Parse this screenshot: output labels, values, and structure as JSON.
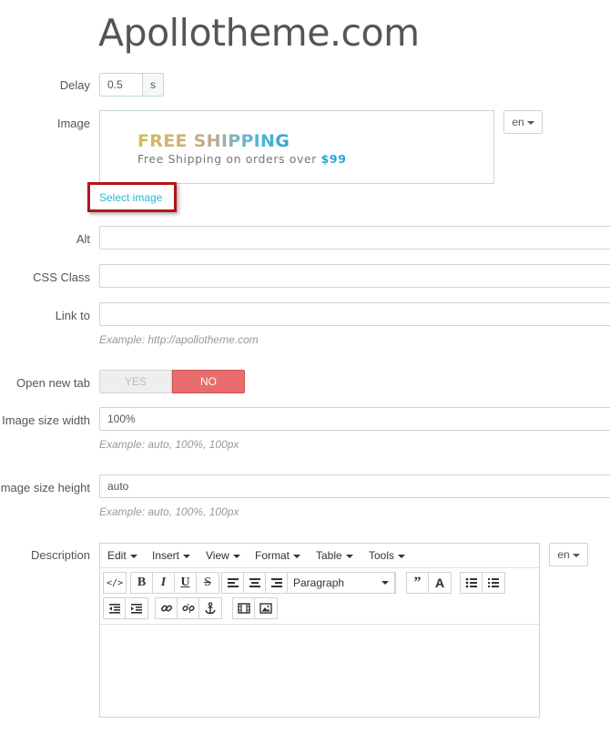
{
  "page": {
    "title": "Apollotheme.com"
  },
  "form": {
    "delay": {
      "label": "Delay",
      "value": "0.5",
      "unit": "s"
    },
    "image": {
      "label": "Image",
      "banner": {
        "title": "FREE SHIPPING",
        "subtitle": "Free Shipping on orders over",
        "price": "$99"
      },
      "select_link": "Select image",
      "language": "en"
    },
    "alt": {
      "label": "Alt",
      "value": ""
    },
    "css_class": {
      "label": "CSS Class",
      "value": ""
    },
    "link_to": {
      "label": "Link to",
      "value": "",
      "help": "Example: http://apollotheme.com"
    },
    "open_new_tab": {
      "label": "Open new tab",
      "yes_label": "YES",
      "no_label": "NO",
      "selected": "NO"
    },
    "image_width": {
      "label": "Image size width",
      "value": "100%",
      "help": "Example: auto, 100%, 100px"
    },
    "image_height": {
      "label": "Image size height",
      "value": "auto",
      "help": "Example: auto, 100%, 100px"
    },
    "description": {
      "label": "Description",
      "language": "en",
      "menu": [
        "Edit",
        "Insert",
        "View",
        "Format",
        "Table",
        "Tools"
      ],
      "format_select": "Paragraph",
      "toolbar_icons": [
        "code-icon",
        "bold-icon",
        "italic-icon",
        "underline-icon",
        "strikethrough-icon",
        "align-left-icon",
        "align-center-icon",
        "align-right-icon",
        "format-select",
        "blockquote-icon",
        "text-color-icon",
        "bullet-list-icon",
        "numbered-list-icon",
        "outdent-icon",
        "indent-icon",
        "link-icon",
        "unlink-icon",
        "anchor-icon",
        "media-icon",
        "image-icon"
      ]
    }
  },
  "colors": {
    "link": "#25b9d7",
    "toggle_no": "#e76d6d",
    "highlight_border": "#b3141a",
    "input_border": "#c7d6db"
  }
}
